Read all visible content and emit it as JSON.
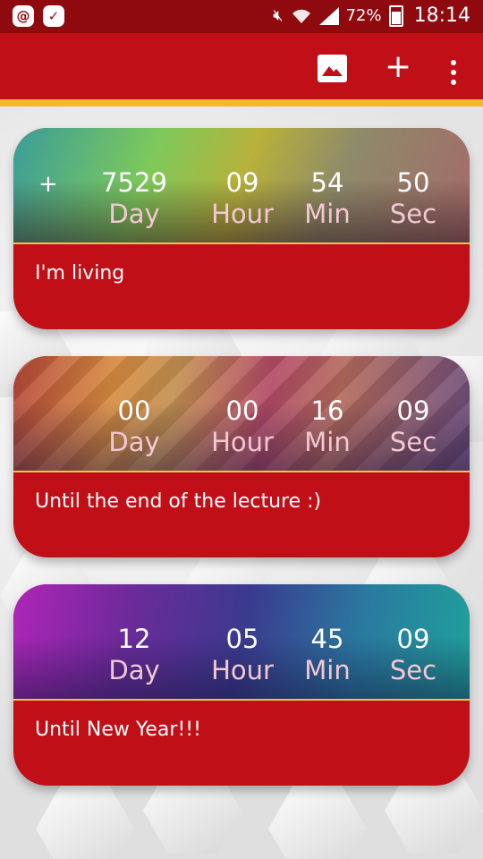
{
  "status_bar": {
    "battery": "72%",
    "time": "18:14"
  },
  "app_bar": {
    "add_label": "+"
  },
  "cards": [
    {
      "sign": "+",
      "day": "7529",
      "hour": "09",
      "min": "54",
      "sec": "50",
      "day_label": "Day",
      "hour_label": "Hour",
      "min_label": "Min",
      "sec_label": "Sec",
      "note": "I'm living"
    },
    {
      "sign": "",
      "day": "00",
      "hour": "00",
      "min": "16",
      "sec": "09",
      "day_label": "Day",
      "hour_label": "Hour",
      "min_label": "Min",
      "sec_label": "Sec",
      "note": "Until the end of the lecture :)"
    },
    {
      "sign": "",
      "day": "12",
      "hour": "05",
      "min": "45",
      "sec": "09",
      "day_label": "Day",
      "hour_label": "Hour",
      "min_label": "Min",
      "sec_label": "Sec",
      "note": "Until New Year!!!"
    }
  ]
}
